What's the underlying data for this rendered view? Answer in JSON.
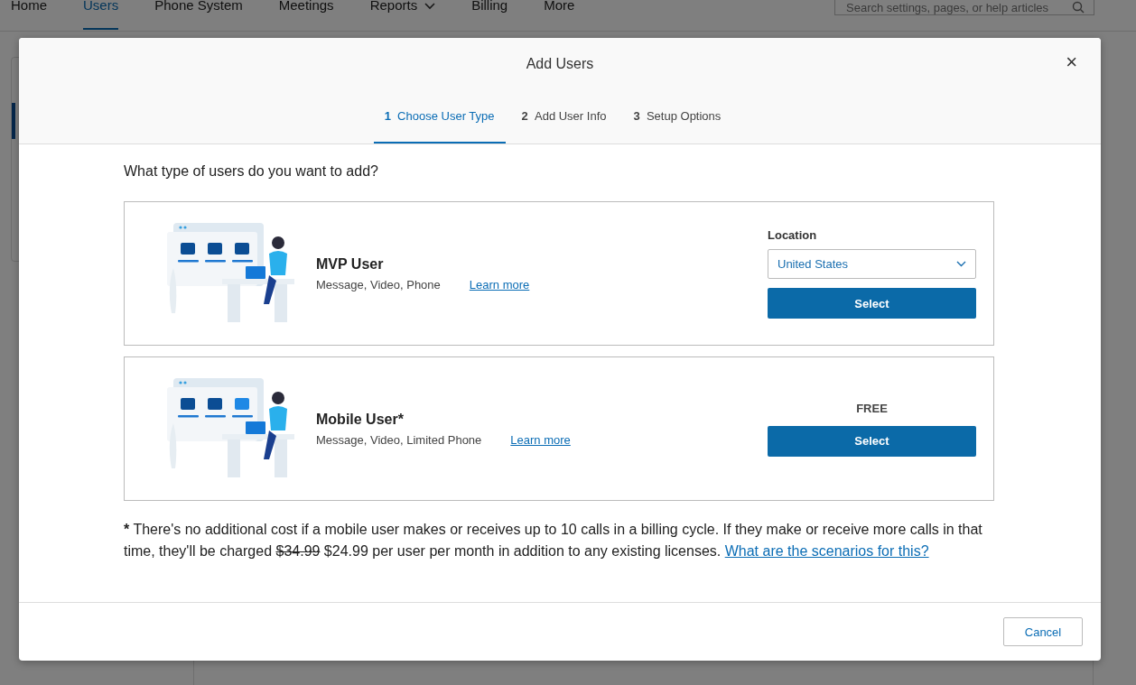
{
  "nav": {
    "items": [
      {
        "label": "Home",
        "selected": false,
        "dropdown": false
      },
      {
        "label": "Users",
        "selected": true,
        "dropdown": false
      },
      {
        "label": "Phone System",
        "selected": false,
        "dropdown": false
      },
      {
        "label": "Meetings",
        "selected": false,
        "dropdown": false
      },
      {
        "label": "Reports",
        "selected": false,
        "dropdown": true
      },
      {
        "label": "Billing",
        "selected": false,
        "dropdown": false
      },
      {
        "label": "More",
        "selected": false,
        "dropdown": false
      }
    ],
    "search": {
      "placeholder": "Search settings, pages, or help articles"
    }
  },
  "dialog": {
    "title": "Add Users",
    "close": "×",
    "steps": [
      {
        "number": "1",
        "label": "Choose User Type",
        "selected": true
      },
      {
        "number": "2",
        "label": "Add User Info",
        "selected": false
      },
      {
        "number": "3",
        "label": "Setup Options",
        "selected": false
      }
    ],
    "question": "What type of users do you want to add?",
    "user_types": [
      {
        "kind": "location",
        "name": "MVP User",
        "features": "Message, Video, Phone",
        "learn_more": "Learn more",
        "location_label": "Location",
        "location_value": "United States",
        "button": "Select"
      },
      {
        "kind": "price",
        "name": "Mobile User*",
        "features": "Message, Video, Limited Phone",
        "learn_more": "Learn more",
        "price": "FREE",
        "button": "Select"
      }
    ],
    "note": {
      "marker": "*",
      "before": "There's no additional cost if a mobile user makes or receives up to 10 calls in a billing cycle. If they make or receive more calls in that time, they'll be charged",
      "old_price": "$34.99",
      "after": "$24.99 per user per month in addition to any existing licenses.",
      "link": "What are the scenarios for this?"
    },
    "cancel": "Cancel"
  }
}
